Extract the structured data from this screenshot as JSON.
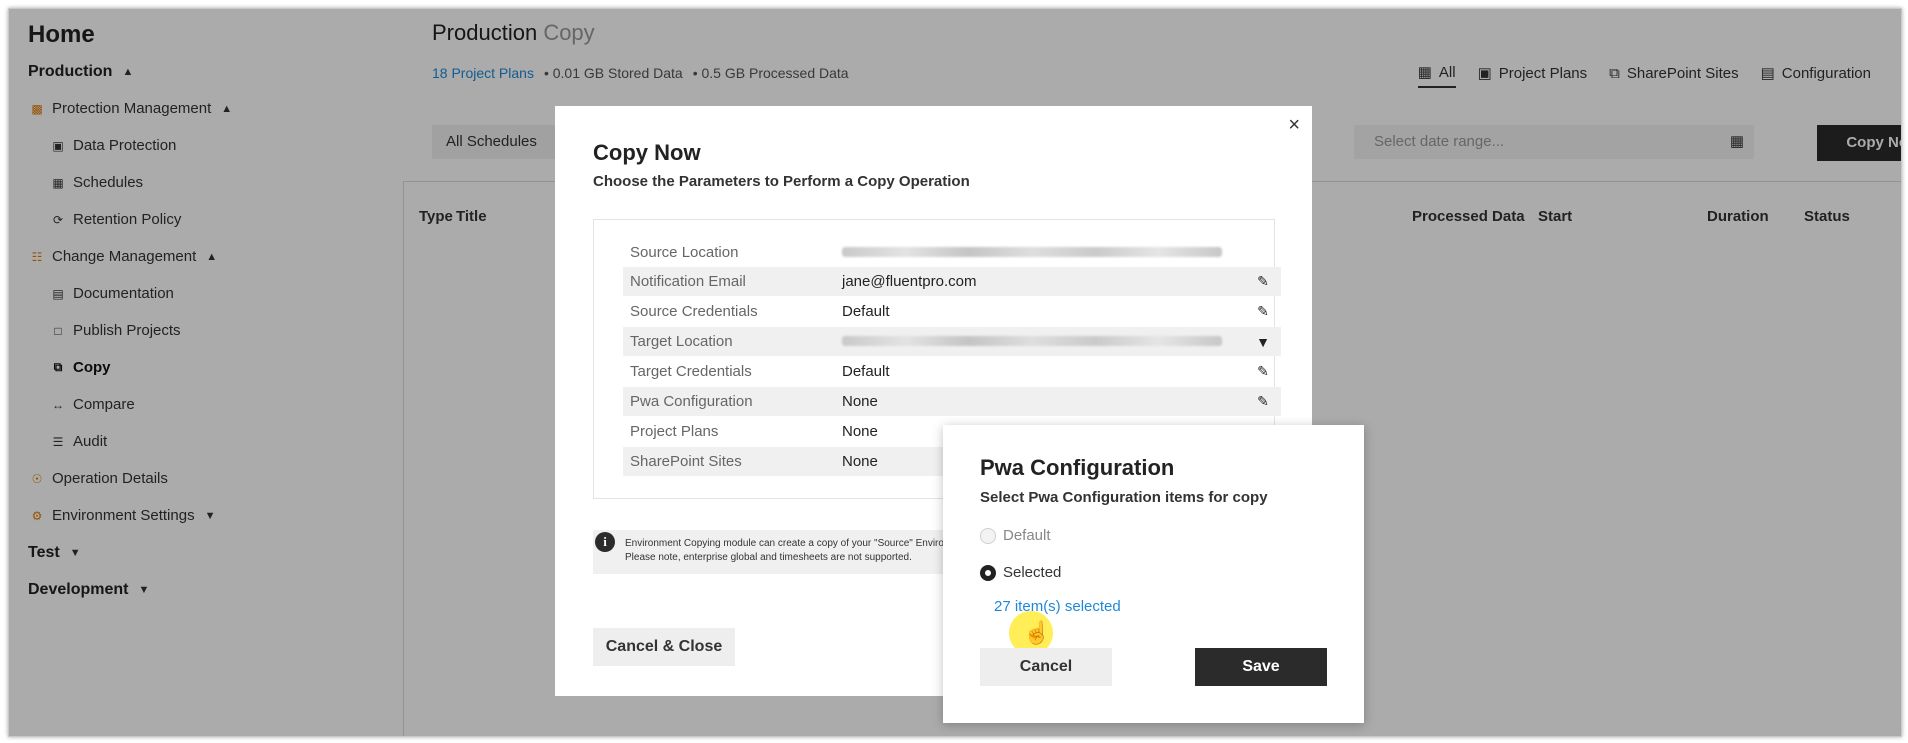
{
  "sidebar": {
    "home": "Home",
    "production": "Production",
    "protection_management": "Protection Management",
    "data_protection": "Data Protection",
    "schedules": "Schedules",
    "retention_policy": "Retention Policy",
    "change_management": "Change Management",
    "documentation": "Documentation",
    "publish_projects": "Publish Projects",
    "copy": "Copy",
    "compare": "Compare",
    "audit": "Audit",
    "operation_details": "Operation Details",
    "environment_settings": "Environment Settings",
    "test": "Test",
    "development": "Development"
  },
  "header": {
    "title": "Production",
    "title_sub": "Copy",
    "project_plans": "18 Project Plans",
    "stored_data": "• 0.01 GB Stored Data",
    "processed_data": "• 0.5 GB Processed Data"
  },
  "tabs": {
    "all": "All",
    "project_plans": "Project Plans",
    "sharepoint_sites": "SharePoint Sites",
    "configuration": "Configuration"
  },
  "toolbar": {
    "schedule_filter": "All Schedules",
    "date_placeholder": "Select date range...",
    "copy_now": "Copy Now"
  },
  "table": {
    "headers": {
      "type": "Type",
      "title": "Title",
      "processed_data": "Processed Data",
      "start": "Start",
      "duration": "Duration",
      "status": "Status"
    }
  },
  "copy_modal": {
    "close": "×",
    "title": "Copy Now",
    "subtitle": "Choose the Parameters to Perform a Copy Operation",
    "params": [
      {
        "label": "Source Location",
        "value": ""
      },
      {
        "label": "Notification Email",
        "value": "jane@fluentpro.com"
      },
      {
        "label": "Source Credentials",
        "value": "Default"
      },
      {
        "label": "Target Location",
        "value": ""
      },
      {
        "label": "Target Credentials",
        "value": "Default"
      },
      {
        "label": "Pwa Configuration",
        "value": "None"
      },
      {
        "label": "Project Plans",
        "value": "None"
      },
      {
        "label": "SharePoint Sites",
        "value": "None"
      }
    ],
    "info_line1": "Environment Copying module can create a copy of your \"Source\" Environment...",
    "info_line2": "Please note, enterprise global and timesheets are not supported.",
    "cancel_close": "Cancel & Close"
  },
  "pwa_dialog": {
    "title": "Pwa Configuration",
    "subtitle": "Select Pwa Configuration items for copy",
    "option_default": "Default",
    "option_selected": "Selected",
    "items_selected": "27 item(s) selected",
    "cancel": "Cancel",
    "save": "Save"
  }
}
